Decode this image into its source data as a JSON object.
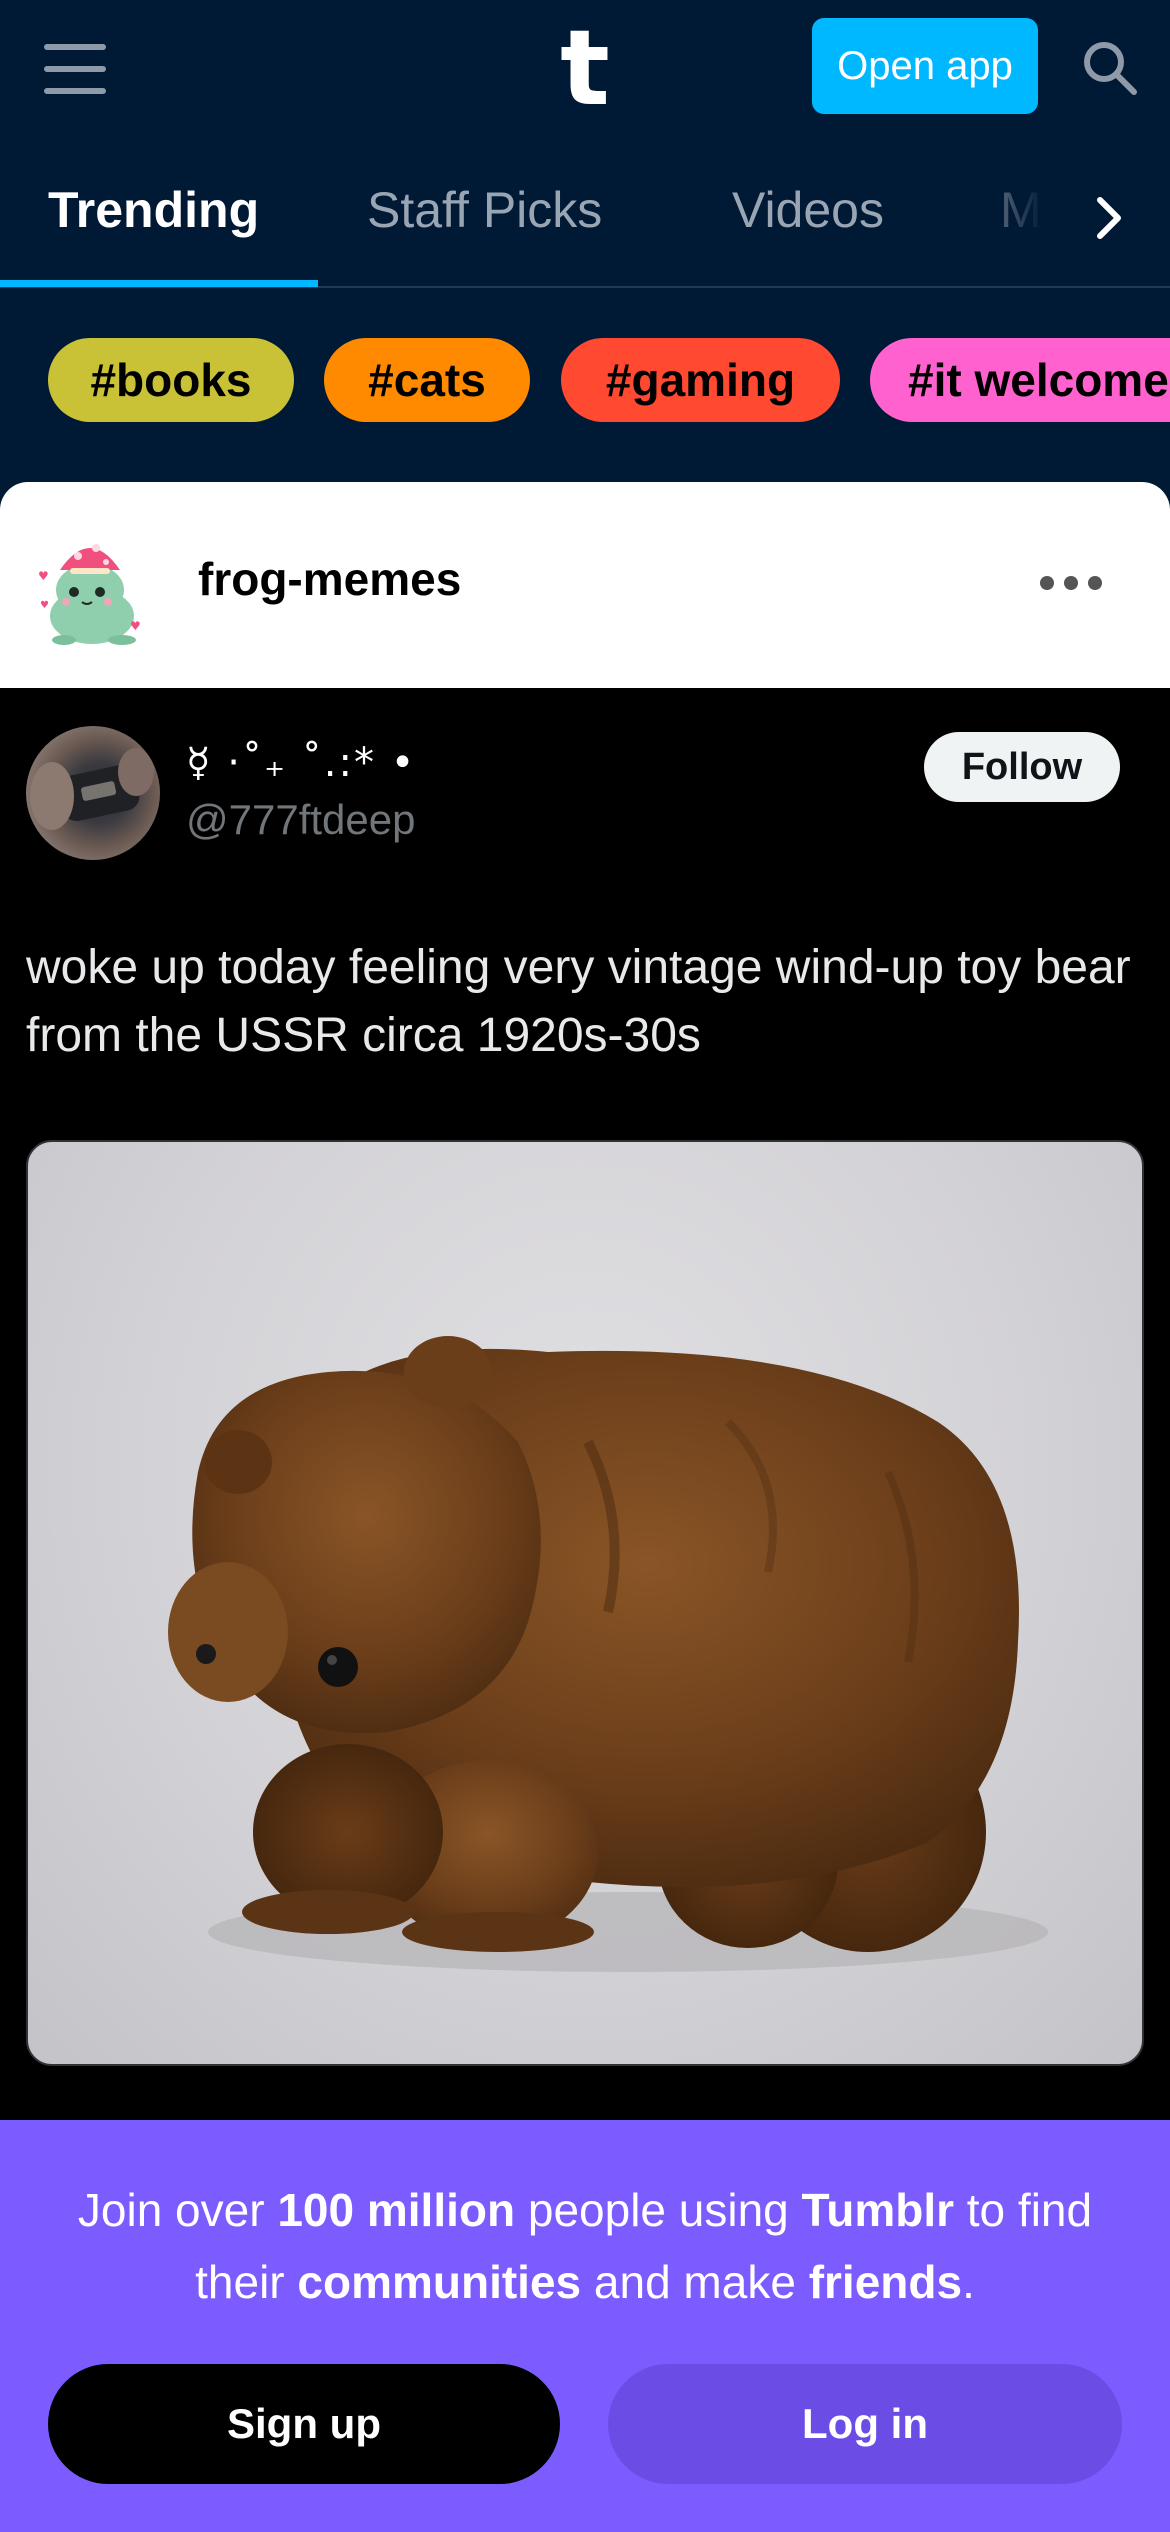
{
  "header": {
    "logo": "t",
    "open_app_label": "Open app",
    "menu_icon": "hamburger-icon",
    "search_icon": "search-icon"
  },
  "tabs": [
    {
      "label": "Trending",
      "active": true
    },
    {
      "label": "Staff Picks",
      "active": false
    },
    {
      "label": "Videos",
      "active": false
    },
    {
      "label": "M",
      "active": false
    }
  ],
  "tabs_next_icon": "chevron-right-icon",
  "chips": [
    {
      "label": "#books",
      "color": "#c9c236"
    },
    {
      "label": "#cats",
      "color": "#ff8a00"
    },
    {
      "label": "#gaming",
      "color": "#ff4930"
    },
    {
      "label": "#it welcome",
      "color": "#ff62ce"
    }
  ],
  "post": {
    "blog_name": "frog-memes",
    "more_icon": "more-options-icon",
    "tweet": {
      "display_name": "☿ ·˚₊ ˚.:* •",
      "handle": "@777ftdeep",
      "follow_label": "Follow",
      "text": "woke up today feeling very vintage wind-up toy bear from the USSR circa 1920s-30s"
    }
  },
  "banner": {
    "line_parts": [
      {
        "text": "Join over ",
        "bold": false
      },
      {
        "text": "100 million",
        "bold": true
      },
      {
        "text": " people using ",
        "bold": false
      },
      {
        "text": "Tumblr",
        "bold": true
      },
      {
        "text": " to find their ",
        "bold": false
      },
      {
        "text": "communities",
        "bold": true
      },
      {
        "text": " and make ",
        "bold": false
      },
      {
        "text": "friends",
        "bold": true
      },
      {
        "text": ".",
        "bold": false
      }
    ],
    "signup_label": "Sign up",
    "login_label": "Log in"
  },
  "colors": {
    "background": "#001935",
    "accent": "#00b8ff",
    "banner": "#7c5cff"
  }
}
